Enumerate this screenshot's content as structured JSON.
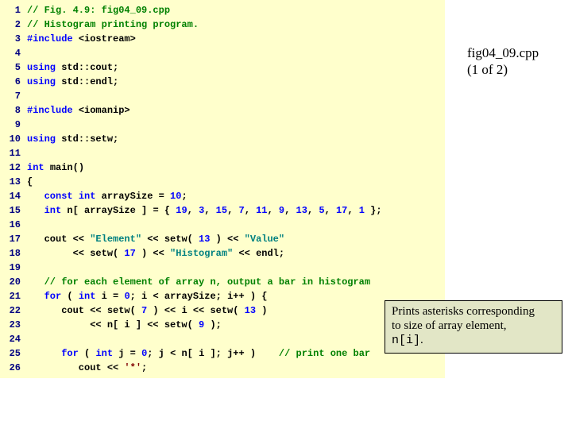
{
  "label": {
    "title": "fig04_09.cpp",
    "subtitle": "(1 of 2)"
  },
  "callout": {
    "line1": "Prints asterisks corresponding",
    "line2": "to size of array element,",
    "arr": "n[i]",
    "period": "."
  },
  "lines": [
    {
      "n": "1",
      "spans": [
        {
          "t": "cmt",
          "v": "// Fig. 4.9: fig04_09.cpp"
        }
      ]
    },
    {
      "n": "2",
      "spans": [
        {
          "t": "cmt",
          "v": "// Histogram printing program."
        }
      ]
    },
    {
      "n": "3",
      "spans": [
        {
          "t": "pp",
          "v": "#include "
        },
        {
          "t": "txt",
          "v": "<iostream>"
        }
      ]
    },
    {
      "n": "4",
      "spans": []
    },
    {
      "n": "5",
      "spans": [
        {
          "t": "kw",
          "v": "using "
        },
        {
          "t": "txt",
          "v": "std::cout;"
        }
      ]
    },
    {
      "n": "6",
      "spans": [
        {
          "t": "kw",
          "v": "using "
        },
        {
          "t": "txt",
          "v": "std::endl;"
        }
      ]
    },
    {
      "n": "7",
      "spans": []
    },
    {
      "n": "8",
      "spans": [
        {
          "t": "pp",
          "v": "#include "
        },
        {
          "t": "txt",
          "v": "<iomanip>"
        }
      ]
    },
    {
      "n": "9",
      "spans": []
    },
    {
      "n": "10",
      "spans": [
        {
          "t": "kw",
          "v": "using "
        },
        {
          "t": "txt",
          "v": "std::setw;"
        }
      ]
    },
    {
      "n": "11",
      "spans": []
    },
    {
      "n": "12",
      "spans": [
        {
          "t": "kw",
          "v": "int "
        },
        {
          "t": "txt",
          "v": "main()"
        }
      ]
    },
    {
      "n": "13",
      "spans": [
        {
          "t": "txt",
          "v": "{"
        }
      ]
    },
    {
      "n": "14",
      "spans": [
        {
          "t": "txt",
          "v": "   "
        },
        {
          "t": "kw",
          "v": "const int "
        },
        {
          "t": "txt",
          "v": "arraySize = "
        },
        {
          "t": "num",
          "v": "10"
        },
        {
          "t": "txt",
          "v": ";"
        }
      ]
    },
    {
      "n": "15",
      "spans": [
        {
          "t": "txt",
          "v": "   "
        },
        {
          "t": "kw",
          "v": "int "
        },
        {
          "t": "txt",
          "v": "n[ arraySize ] = { "
        },
        {
          "t": "num",
          "v": "19"
        },
        {
          "t": "txt",
          "v": ", "
        },
        {
          "t": "num",
          "v": "3"
        },
        {
          "t": "txt",
          "v": ", "
        },
        {
          "t": "num",
          "v": "15"
        },
        {
          "t": "txt",
          "v": ", "
        },
        {
          "t": "num",
          "v": "7"
        },
        {
          "t": "txt",
          "v": ", "
        },
        {
          "t": "num",
          "v": "11"
        },
        {
          "t": "txt",
          "v": ", "
        },
        {
          "t": "num",
          "v": "9"
        },
        {
          "t": "txt",
          "v": ", "
        },
        {
          "t": "num",
          "v": "13"
        },
        {
          "t": "txt",
          "v": ", "
        },
        {
          "t": "num",
          "v": "5"
        },
        {
          "t": "txt",
          "v": ", "
        },
        {
          "t": "num",
          "v": "17"
        },
        {
          "t": "txt",
          "v": ", "
        },
        {
          "t": "num",
          "v": "1"
        },
        {
          "t": "txt",
          "v": " };"
        }
      ]
    },
    {
      "n": "16",
      "spans": []
    },
    {
      "n": "17",
      "spans": [
        {
          "t": "txt",
          "v": "   cout << "
        },
        {
          "t": "str",
          "v": "\"Element\""
        },
        {
          "t": "txt",
          "v": " << setw( "
        },
        {
          "t": "num",
          "v": "13"
        },
        {
          "t": "txt",
          "v": " ) << "
        },
        {
          "t": "str",
          "v": "\"Value\""
        }
      ]
    },
    {
      "n": "18",
      "spans": [
        {
          "t": "txt",
          "v": "        << setw( "
        },
        {
          "t": "num",
          "v": "17"
        },
        {
          "t": "txt",
          "v": " ) << "
        },
        {
          "t": "str",
          "v": "\"Histogram\""
        },
        {
          "t": "txt",
          "v": " << endl;"
        }
      ]
    },
    {
      "n": "19",
      "spans": []
    },
    {
      "n": "20",
      "spans": [
        {
          "t": "txt",
          "v": "   "
        },
        {
          "t": "cmt",
          "v": "// for each element of array n, output a bar in histogram"
        }
      ]
    },
    {
      "n": "21",
      "spans": [
        {
          "t": "txt",
          "v": "   "
        },
        {
          "t": "kw",
          "v": "for "
        },
        {
          "t": "txt",
          "v": "( "
        },
        {
          "t": "kw",
          "v": "int "
        },
        {
          "t": "txt",
          "v": "i = "
        },
        {
          "t": "num",
          "v": "0"
        },
        {
          "t": "txt",
          "v": "; i < arraySize; i++ ) {"
        }
      ]
    },
    {
      "n": "22",
      "spans": [
        {
          "t": "txt",
          "v": "      cout << setw( "
        },
        {
          "t": "num",
          "v": "7"
        },
        {
          "t": "txt",
          "v": " ) << i << setw( "
        },
        {
          "t": "num",
          "v": "13"
        },
        {
          "t": "txt",
          "v": " )"
        }
      ]
    },
    {
      "n": "23",
      "spans": [
        {
          "t": "txt",
          "v": "           << n[ i ] << setw( "
        },
        {
          "t": "num",
          "v": "9"
        },
        {
          "t": "txt",
          "v": " );"
        }
      ]
    },
    {
      "n": "24",
      "spans": []
    },
    {
      "n": "25",
      "spans": [
        {
          "t": "txt",
          "v": "      "
        },
        {
          "t": "kw",
          "v": "for "
        },
        {
          "t": "txt",
          "v": "( "
        },
        {
          "t": "kw",
          "v": "int "
        },
        {
          "t": "txt",
          "v": "j = "
        },
        {
          "t": "num",
          "v": "0"
        },
        {
          "t": "txt",
          "v": "; j < n[ i ]; j++ )    "
        },
        {
          "t": "cmt",
          "v": "// print one bar"
        }
      ]
    },
    {
      "n": "26",
      "spans": [
        {
          "t": "txt",
          "v": "         cout << "
        },
        {
          "t": "chlit",
          "v": "'*'"
        },
        {
          "t": "txt",
          "v": ";"
        }
      ]
    }
  ]
}
